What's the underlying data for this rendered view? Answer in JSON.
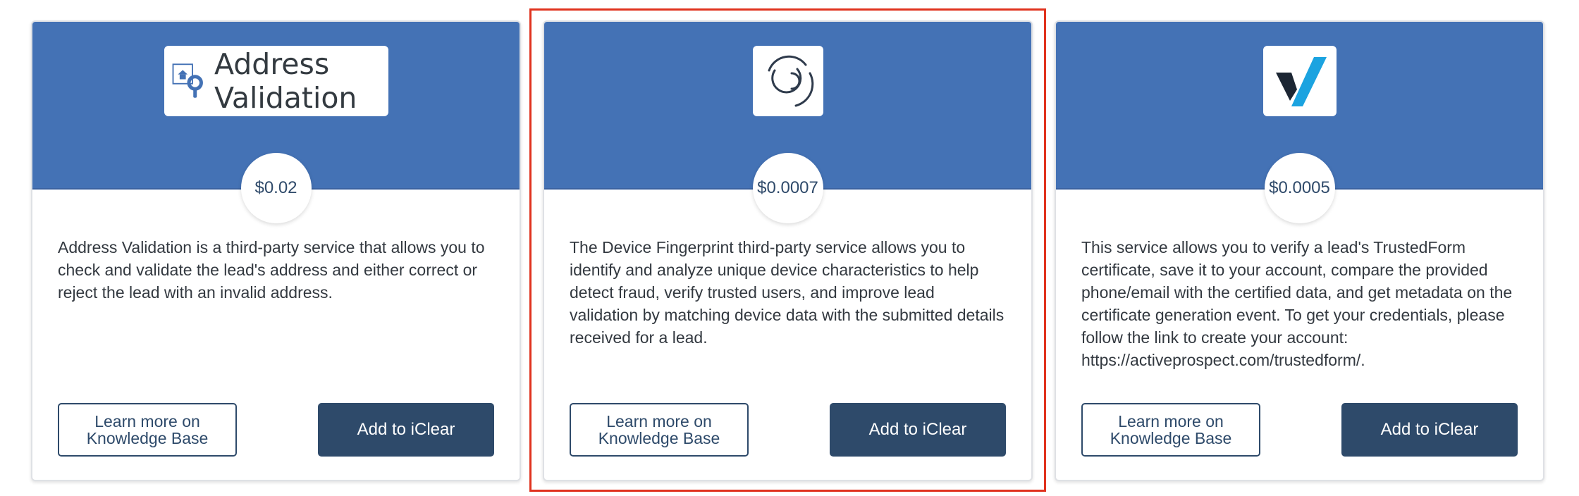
{
  "cards": [
    {
      "logo_text": "Address Validation",
      "logo_icon": "address-validation-logo-icon",
      "price": "$0.02",
      "description": "Address Validation is a third-party service that allows you to check and validate the lead's address and either correct or reject the lead with an invalid address.",
      "learn_label": "Learn more on\nKnowledge Base",
      "add_label": "Add to iClear"
    },
    {
      "logo_icon": "device-fingerprint-logo-icon",
      "price": "$0.0007",
      "description": "The Device Fingerprint third-party service allows you to identify and analyze unique device characteristics to help detect fraud, verify trusted users, and improve lead validation by matching device data with the submitted details received for a lead.",
      "learn_label": "Learn more on\nKnowledge Base",
      "add_label": "Add to iClear"
    },
    {
      "logo_icon": "trustedform-logo-icon",
      "price": "$0.0005",
      "description": "This service allows you to verify a lead's TrustedForm certificate, save it to your account, compare the provided phone/email with the certified data, and get metadata on the certificate generation event. To get your credentials, please follow the link to create your account: https://activeprospect.com/trustedform/.",
      "learn_label": "Learn more on\nKnowledge Base",
      "add_label": "Add to iClear"
    }
  ],
  "colors": {
    "header_blue": "#4472b5",
    "button_navy": "#2e4a6a",
    "highlight_red": "#e0321e",
    "trustedform_blue": "#1ba3e0",
    "trustedform_dark": "#1c2633"
  }
}
